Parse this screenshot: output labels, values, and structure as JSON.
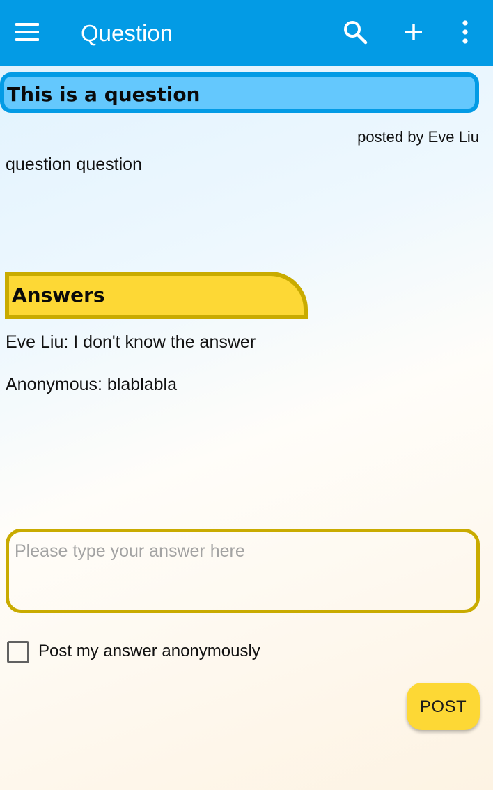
{
  "appbar": {
    "title": "Question",
    "background_color": "#039be5",
    "icons": [
      "menu-icon",
      "search-icon",
      "add-icon",
      "more-vert-icon"
    ]
  },
  "question": {
    "title": "This is a question",
    "posted_by": "posted by Eve Liu",
    "body": "question question",
    "box_color": "#64c8fd",
    "border_color": "#039be5"
  },
  "answers": {
    "header": "Answers",
    "header_color": "#fdd835",
    "border_color": "#c9ab00",
    "items": [
      {
        "text": "Eve Liu: I don't know the answer"
      },
      {
        "text": "Anonymous: blablabla"
      }
    ]
  },
  "answer_form": {
    "input_value": "",
    "input_placeholder": "Please type your answer here",
    "anonymous_label": "Post my answer anonymously",
    "anonymous_checked": false,
    "post_label": "POST"
  }
}
